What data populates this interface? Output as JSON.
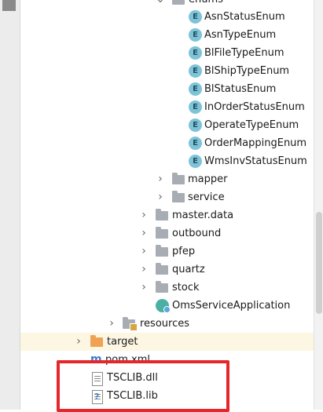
{
  "tree": {
    "enums_folder": "enums",
    "enum_items": [
      "AsnStatusEnum",
      "AsnTypeEnum",
      "BlFileTypeEnum",
      "BlShipTypeEnum",
      "BlStatusEnum",
      "InOrderStatusEnum",
      "OperateTypeEnum",
      "OrderMappingEnum",
      "WmsInvStatusEnum"
    ],
    "enum_badge": "E",
    "mapper": "mapper",
    "service": "service",
    "master_data": "master.data",
    "outbound": "outbound",
    "pfep": "pfep",
    "quartz": "quartz",
    "stock": "stock",
    "app_class": "OmsServiceApplication",
    "resources": "resources",
    "target": "target",
    "pom": "pom.xml",
    "pom_badge": "m",
    "tsclib_dll": "TSCLIB.dll",
    "tsclib_lib": "TSCLIB.lib"
  },
  "colors": {
    "highlight_row": "#fcf6e3",
    "red_box": "#e5262b",
    "enum_icon": "#7fc3d8",
    "target_folder": "#f0a254"
  }
}
